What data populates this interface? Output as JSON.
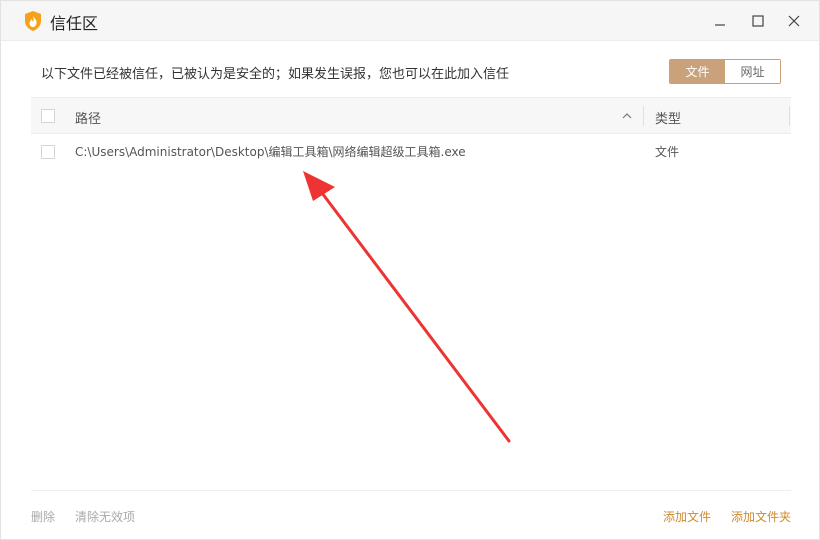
{
  "window": {
    "title": "信任区",
    "icons": {
      "logo": "shield-flame-icon",
      "minimize": "minimize-icon",
      "maximize": "maximize-icon",
      "close": "close-icon"
    }
  },
  "header": {
    "description": "以下文件已经被信任，已被认为是安全的；如果发生误报，您也可以在此加入信任",
    "tabs": [
      {
        "label": "文件",
        "active": true
      },
      {
        "label": "网址",
        "active": false
      }
    ]
  },
  "table": {
    "columns": {
      "path": "路径",
      "type": "类型"
    },
    "sort_icon": "chevron-up-icon",
    "rows": [
      {
        "path": "C:\\Users\\Administrator\\Desktop\\编辑工具箱\\网络编辑超级工具箱.exe",
        "type": "文件"
      }
    ]
  },
  "footer": {
    "delete_label": "删除",
    "clear_label": "清除无效项",
    "add_file_label": "添加文件",
    "add_folder_label": "添加文件夹"
  },
  "colors": {
    "accent": "#c9a27b",
    "link": "#d08a2c",
    "annotation_arrow": "#ee3333"
  }
}
